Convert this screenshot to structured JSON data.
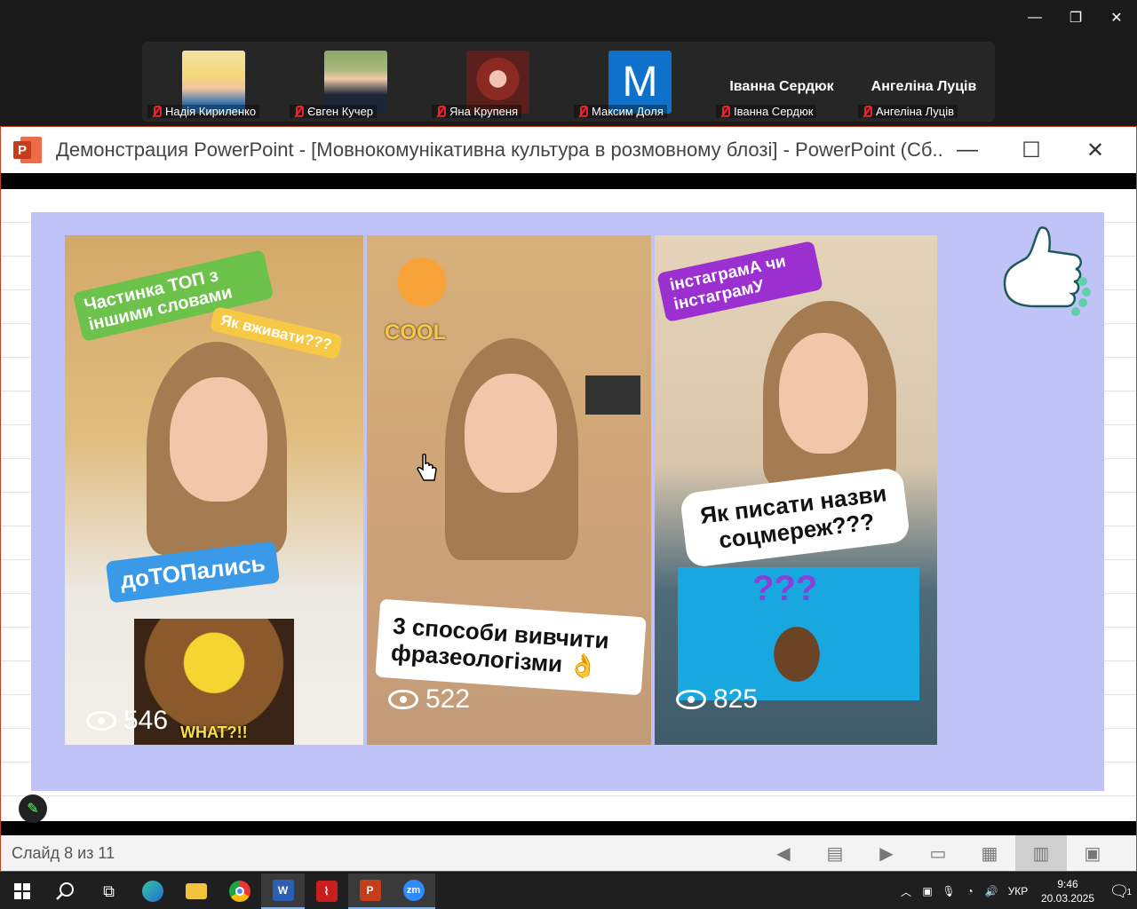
{
  "zoom": {
    "participants": [
      {
        "name": "Надія Кириленко",
        "avatar": "photo"
      },
      {
        "name": "Євген Кучер",
        "avatar": "photo"
      },
      {
        "name": "Яна Крупеня",
        "avatar": "photo"
      },
      {
        "name": "Максим Доля",
        "avatar": "letter",
        "letter": "M"
      },
      {
        "name": "Іванна Сердюк",
        "avatar": "name",
        "display": "Іванна Сердюк"
      },
      {
        "name": "Ангеліна Луців",
        "avatar": "name",
        "display": "Ангеліна Луців"
      }
    ],
    "window_controls": {
      "minimize": "—",
      "restore": "❐",
      "close": "✕"
    }
  },
  "powerpoint": {
    "title": "Демонстрация PowerPoint - [Мовнокомунікативна культура в розмовному блозі] - PowerPoint (Сб...",
    "logo_letter": "P",
    "controls": {
      "minimize": "—",
      "maximize": "☐",
      "close": "✕"
    },
    "slide": {
      "videos": [
        {
          "tags": [
            "Частинка ТОП з іншими словами",
            "Як вживати???",
            "доТОПались"
          ],
          "overlay": "WHAT?!!",
          "views": "546"
        },
        {
          "tags": [
            "COOL",
            "3 способи вивчити фразеологізми 👌"
          ],
          "views": "522"
        },
        {
          "tags": [
            "інстаграмА чи інстаграмУ",
            "Як писати назви соцмереж???",
            "???"
          ],
          "views": "825"
        }
      ],
      "colors": {
        "panel": "#bfc3f7",
        "green_tag": "#6cc24a",
        "yellow_tag": "#f7c843",
        "blue_tag": "#3a9ae8",
        "purple_tag": "#9b2fd0"
      }
    },
    "status": {
      "slide_counter": "Слайд 8 из 11",
      "icons": [
        "prev-icon",
        "menu-icon",
        "next-icon",
        "normal-view-icon",
        "slide-sorter-icon",
        "reading-view-icon",
        "slideshow-icon"
      ]
    }
  },
  "taskbar": {
    "apps": [
      "windows-start",
      "search",
      "task-view",
      "edge",
      "file-explorer",
      "chrome",
      "word",
      "acrobat",
      "powerpoint",
      "zoom"
    ],
    "word_letter": "W",
    "ppt_letter": "P",
    "zoom_letters": "zm",
    "language": "УКР",
    "time": "9:46",
    "date": "20.03.2025",
    "notifications": "1"
  }
}
